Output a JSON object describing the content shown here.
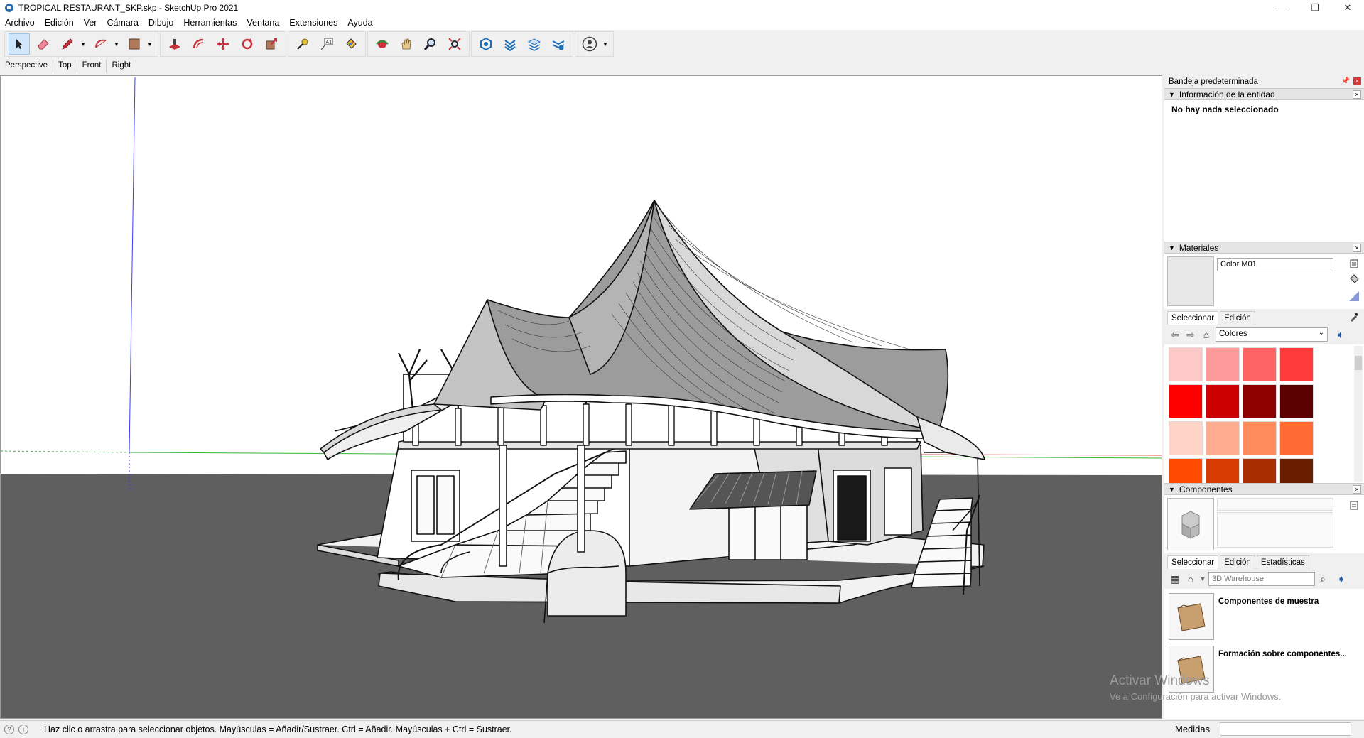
{
  "window": {
    "title": "TROPICAL RESTAURANT_SKP.skp - SketchUp Pro 2021",
    "controls": {
      "minimize": "—",
      "restore": "❐",
      "close": "✕"
    }
  },
  "menubar": {
    "items": [
      "Archivo",
      "Edición",
      "Ver",
      "Cámara",
      "Dibujo",
      "Herramientas",
      "Ventana",
      "Extensiones",
      "Ayuda"
    ]
  },
  "scene_tabs": [
    "Perspective",
    "Top",
    "Front",
    "Right"
  ],
  "tray": {
    "title": "Bandeja predeterminada",
    "entity_info": {
      "header": "Información de la entidad",
      "message": "No hay nada seleccionado"
    },
    "materials": {
      "header": "Materiales",
      "name_value": "Color M01",
      "tabs": [
        "Seleccionar",
        "Edición"
      ],
      "library": "Colores",
      "swatches": [
        "#ffc8c8",
        "#ff9a9a",
        "#ff6464",
        "#ff3a3a",
        "#ff0000",
        "#cc0000",
        "#8c0000",
        "#5a0000",
        "#ffd4c8",
        "#ffad90",
        "#ff8a5a",
        "#ff6a35",
        "#ff4a00",
        "#d63c00",
        "#a82e00",
        "#6a1e00"
      ]
    },
    "components": {
      "header": "Componentes",
      "tabs": [
        "Seleccionar",
        "Edición",
        "Estadísticas"
      ],
      "search_placeholder": "3D Warehouse",
      "items": [
        "Componentes de muestra",
        "Formación sobre componentes..."
      ]
    }
  },
  "statusbar": {
    "message": "Haz clic o arrastra para seleccionar objetos. Mayúsculas = Añadir/Sustraer. Ctrl = Añadir. Mayúsculas + Ctrl = Sustraer.",
    "measure_label": "Medidas",
    "measure_value": ""
  },
  "watermark": {
    "line1": "Activar Windows",
    "line2": "Ve a Configuración para activar Windows."
  },
  "colors": {
    "ground": "#5f5f5f",
    "sky": "#ffffff",
    "axis_blue": "#3a3aff",
    "axis_green": "#3cb43c",
    "axis_red": "#e04040"
  }
}
